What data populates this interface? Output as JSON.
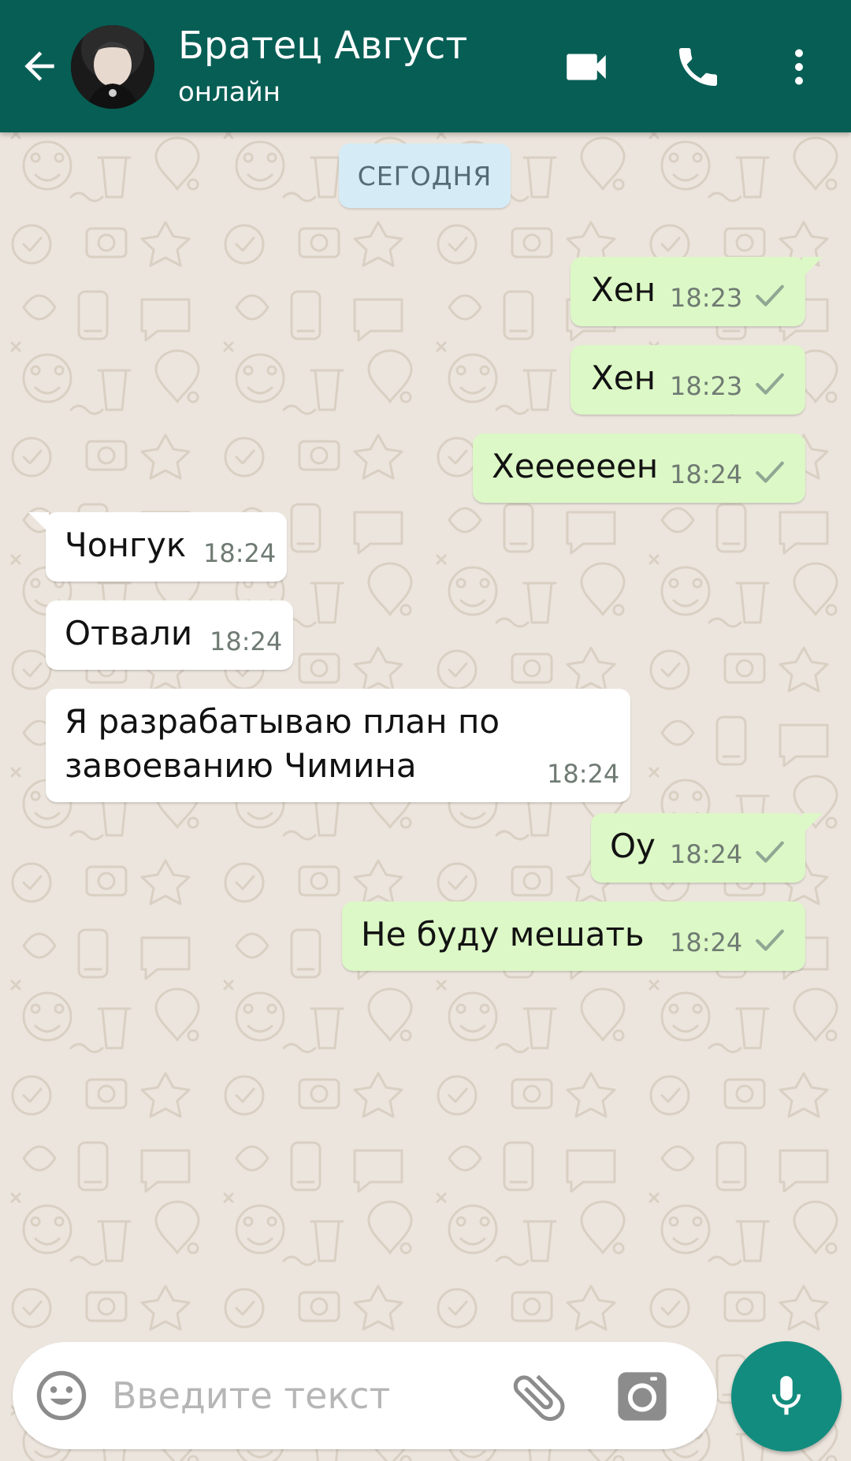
{
  "header": {
    "contact_name": "Братец Август",
    "status": "онлайн"
  },
  "chat": {
    "date_label": "СЕГОДНЯ",
    "messages": [
      {
        "direction": "out",
        "text": "Хен",
        "time": "18:23",
        "status": "sent"
      },
      {
        "direction": "out",
        "text": "Хен",
        "time": "18:23",
        "status": "sent"
      },
      {
        "direction": "out",
        "text": "Хеееееен",
        "time": "18:24",
        "status": "sent"
      },
      {
        "direction": "in",
        "text": "Чонгук",
        "time": "18:24"
      },
      {
        "direction": "in",
        "text": "Отвали",
        "time": "18:24"
      },
      {
        "direction": "in",
        "lines": [
          "Я разрабатываю план по",
          "завоеванию Чимина"
        ],
        "time": "18:24"
      },
      {
        "direction": "out",
        "text": "Оу",
        "time": "18:24",
        "status": "sent"
      },
      {
        "direction": "out",
        "text": "Не буду мешать",
        "time": "18:24",
        "status": "sent"
      }
    ]
  },
  "composer": {
    "placeholder": "Введите текст",
    "value": ""
  },
  "icons": {
    "back": "arrow-left-icon",
    "video": "video-camera-icon",
    "call": "phone-icon",
    "menu": "more-vertical-icon",
    "emoji": "emoji-icon",
    "attach": "paperclip-icon",
    "camera": "camera-icon",
    "mic": "microphone-icon",
    "tick": "single-check-icon"
  },
  "colors": {
    "header": "#075e54",
    "outgoing_bubble": "#dcf8c6",
    "incoming_bubble": "#ffffff",
    "date_pill": "#d5ecf7",
    "mic_button": "#128c7e",
    "chat_background": "#ece5dd"
  }
}
